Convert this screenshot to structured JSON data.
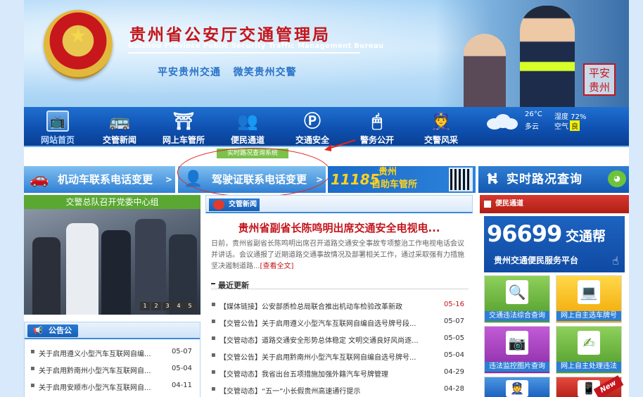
{
  "header": {
    "title_cn": "贵州省公安厅交通管理局",
    "title_en": "Guizhou Province Public Security Traffic Management Bureau",
    "slogan": "平安贵州交通   微笑贵州交警",
    "seal_text": "平安贵州"
  },
  "nav": {
    "items": [
      {
        "label": "网站首页",
        "icon": "tv-icon",
        "glyph": "📺"
      },
      {
        "label": "交管新闻",
        "icon": "bus-icon",
        "glyph": "🚌"
      },
      {
        "label": "网上车管所",
        "icon": "toll-gate-icon",
        "glyph": "⛩"
      },
      {
        "label": "便民通道",
        "icon": "people-icon",
        "glyph": "👥"
      },
      {
        "label": "交通安全",
        "icon": "no-parking-icon",
        "glyph": "Ⓟ"
      },
      {
        "label": "警务公开",
        "icon": "mouse-icon",
        "glyph": "🖱"
      },
      {
        "label": "交警风采",
        "icon": "police-officer-icon",
        "glyph": "👮"
      }
    ]
  },
  "weather": {
    "temp": "26°C",
    "condition": "多云",
    "humidity": "湿度 72%",
    "air_label": "空气",
    "air_quality": "良"
  },
  "realtime_tag": "实时路况查询系统",
  "quick_links": {
    "vehicle_phone": "机动车联系电话变更",
    "license_phone": "驾驶证联系电话变更",
    "hotline_number": "11185",
    "self_service_line1": "贵州",
    "self_service_line2": "自助车管所",
    "realtime_traffic": "实时路况查询"
  },
  "photo_box": {
    "title": "交警总队召开党委中心组",
    "pages": [
      "1",
      "2",
      "3",
      "4",
      "5"
    ]
  },
  "notice": {
    "header": "公告公示",
    "items": [
      {
        "title": "关于启用遵义小型汽车互联网自编...",
        "date": "05-07"
      },
      {
        "title": "关于启用黔南州小型汽车互联网自...",
        "date": "05-04"
      },
      {
        "title": "关于启用安顺市小型汽车互联网自...",
        "date": "04-11"
      }
    ]
  },
  "news": {
    "header": "交管新闻",
    "headline": "贵州省副省长陈鸣明出席交通安全电视电...",
    "summary": "日前，贵州省副省长陈鸣明出席召开道路交通安全事故专项整治工作电视电话会议并讲话。会议通报了近期道路交通事故情况及部署相关工作，通过采取强有力措施坚决遏制道路...",
    "more": "[查看全文]",
    "recent_title": "最近更新",
    "items": [
      {
        "title": "【媒体链接】公安部质检总局联合推出机动车检验改革新政",
        "date": "05-16",
        "hot": true
      },
      {
        "title": "【交管公告】关于启用遵义小型汽车互联网自编自选号牌号段...",
        "date": "05-07",
        "hot": false
      },
      {
        "title": "【交管动态】道路交通安全形势总体稳定 文明交通良好风尚逐...",
        "date": "05-05",
        "hot": false
      },
      {
        "title": "【交管公告】关于启用黔南州小型汽车互联网自编自选号牌号...",
        "date": "05-04",
        "hot": false
      },
      {
        "title": "【交管动态】我省出台五项措施加强外籍汽车号牌管理",
        "date": "04-29",
        "hot": false
      },
      {
        "title": "【交管动态】“五一”小长假贵州高速通行提示",
        "date": "04-28",
        "hot": false
      }
    ]
  },
  "services": {
    "header": "便民通道",
    "hotline_number": "96699",
    "hotline_brand": "交通帮",
    "hotline_sub": "贵州交通便民服务平台",
    "tiles": [
      {
        "label": "交通违法综合查询",
        "icon": "magnifier-doc-icon",
        "glyph": "🔍"
      },
      {
        "label": "网上自主选车牌号",
        "icon": "laptop-icon",
        "glyph": "💻"
      },
      {
        "label": "违法监控图片查询",
        "icon": "camera-icon",
        "glyph": "📷"
      },
      {
        "label": "网上自主处理违法",
        "icon": "pen-doc-icon",
        "glyph": "✍"
      }
    ],
    "new_badge": "New"
  }
}
